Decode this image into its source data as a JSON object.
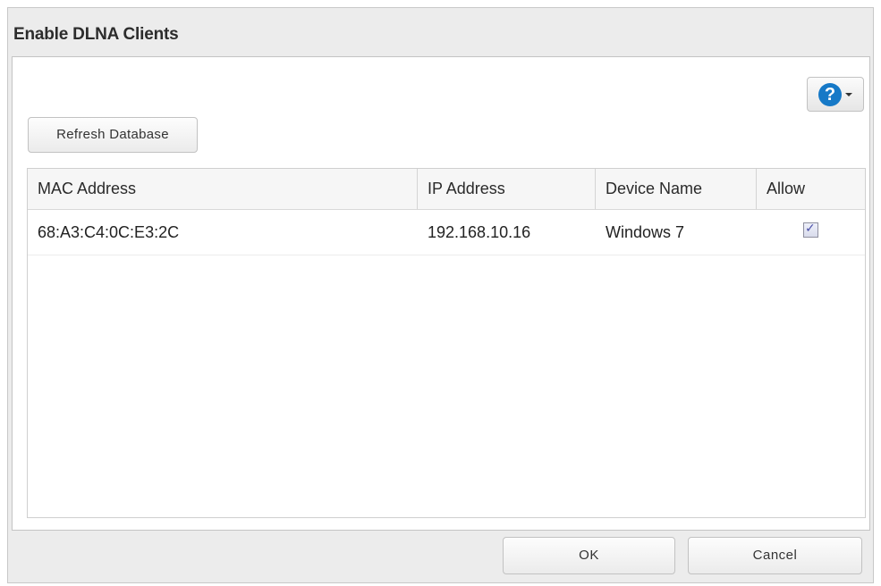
{
  "dialog": {
    "title": "Enable DLNA Clients"
  },
  "toolbar": {
    "refresh_label": "Refresh Database",
    "help_icon": "question-circle-icon",
    "help_glyph": "?",
    "help_accent": "#1679c7"
  },
  "table": {
    "columns": [
      "MAC Address",
      "IP Address",
      "Device Name",
      "Allow"
    ],
    "rows": [
      {
        "mac": "68:A3:C4:0C:E3:2C",
        "ip": "192.168.10.16",
        "device": "Windows 7",
        "allow": true
      }
    ]
  },
  "footer": {
    "ok_label": "OK",
    "cancel_label": "Cancel"
  }
}
